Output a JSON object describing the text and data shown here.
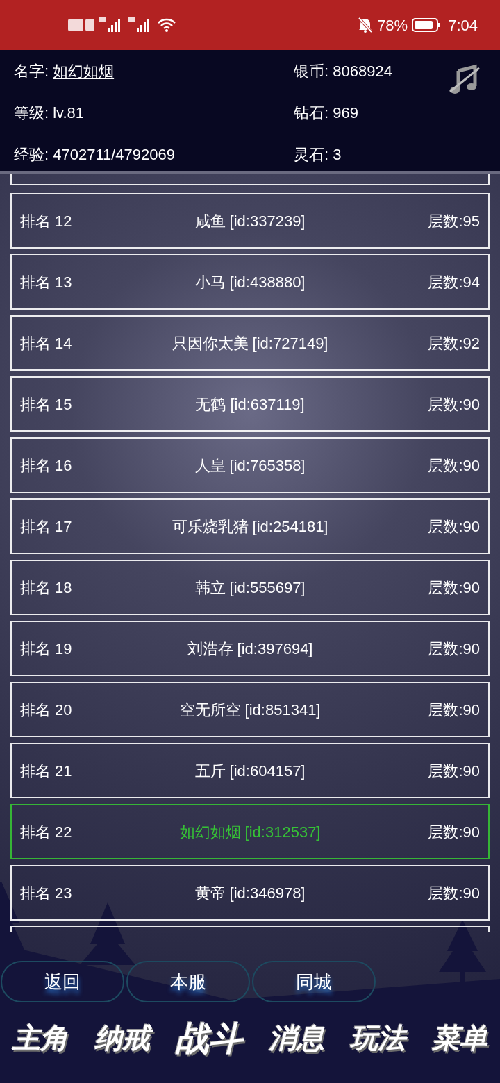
{
  "status_bar": {
    "battery": "78%",
    "time": "7:04"
  },
  "player": {
    "name_label": "名字:",
    "name": "如幻如烟",
    "silver": "银币: 8068924",
    "level": "等级: lv.81",
    "diamond": "钻石: 969",
    "exp": "经验: 4702711/4792069",
    "spirit_stone": "灵石: 3"
  },
  "ranking": [
    {
      "rank": "排名 12",
      "player": "咸鱼 [id:337239]",
      "floors": "层数:95",
      "selected": false
    },
    {
      "rank": "排名 13",
      "player": "小马 [id:438880]",
      "floors": "层数:94",
      "selected": false
    },
    {
      "rank": "排名 14",
      "player": "只因你太美 [id:727149]",
      "floors": "层数:92",
      "selected": false
    },
    {
      "rank": "排名 15",
      "player": "无鹤 [id:637119]",
      "floors": "层数:90",
      "selected": false
    },
    {
      "rank": "排名 16",
      "player": "人皇 [id:765358]",
      "floors": "层数:90",
      "selected": false
    },
    {
      "rank": "排名 17",
      "player": "可乐烧乳猪 [id:254181]",
      "floors": "层数:90",
      "selected": false
    },
    {
      "rank": "排名 18",
      "player": "韩立 [id:555697]",
      "floors": "层数:90",
      "selected": false
    },
    {
      "rank": "排名 19",
      "player": "刘浩存 [id:397694]",
      "floors": "层数:90",
      "selected": false
    },
    {
      "rank": "排名 20",
      "player": "空无所空 [id:851341]",
      "floors": "层数:90",
      "selected": false
    },
    {
      "rank": "排名 21",
      "player": "五斤 [id:604157]",
      "floors": "层数:90",
      "selected": false
    },
    {
      "rank": "排名 22",
      "player": "如幻如烟 [id:312537]",
      "floors": "层数:90",
      "selected": true
    },
    {
      "rank": "排名 23",
      "player": "黄帝 [id:346978]",
      "floors": "层数:90",
      "selected": false
    }
  ],
  "buttons": [
    "返回",
    "本服",
    "同城"
  ],
  "nav": [
    "主角",
    "纳戒",
    "战斗",
    "消息",
    "玩法",
    "菜单"
  ]
}
